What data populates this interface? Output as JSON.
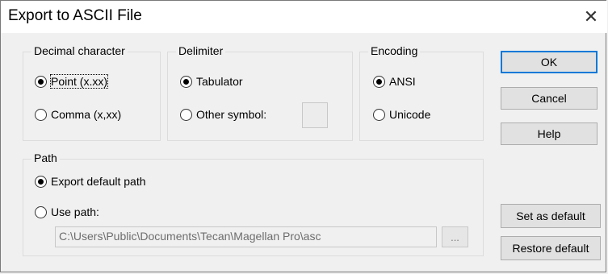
{
  "window": {
    "title": "Export to ASCII File",
    "close_glyph": "✕"
  },
  "decimal": {
    "label": "Decimal character",
    "options": [
      {
        "label": "Point (x.xx)",
        "checked": true
      },
      {
        "label": "Comma (x,xx)",
        "checked": false
      }
    ]
  },
  "delimiter": {
    "label": "Delimiter",
    "options": [
      {
        "label": "Tabulator",
        "checked": true
      },
      {
        "label": "Other symbol:",
        "checked": false
      }
    ],
    "symbol_value": ""
  },
  "encoding": {
    "label": "Encoding",
    "options": [
      {
        "label": "ANSI",
        "checked": true
      },
      {
        "label": "Unicode",
        "checked": false
      }
    ]
  },
  "path": {
    "label": "Path",
    "options": [
      {
        "label": "Export default path",
        "checked": true
      },
      {
        "label": "Use path:",
        "checked": false
      }
    ],
    "value": "C:\\Users\\Public\\Documents\\Tecan\\Magellan Pro\\asc",
    "browse_label": "..."
  },
  "buttons": {
    "ok": "OK",
    "cancel": "Cancel",
    "help": "Help",
    "set_default": "Set as default",
    "restore_default": "Restore default"
  },
  "colors": {
    "accent": "#0078d7",
    "background": "#f0f0f0"
  }
}
